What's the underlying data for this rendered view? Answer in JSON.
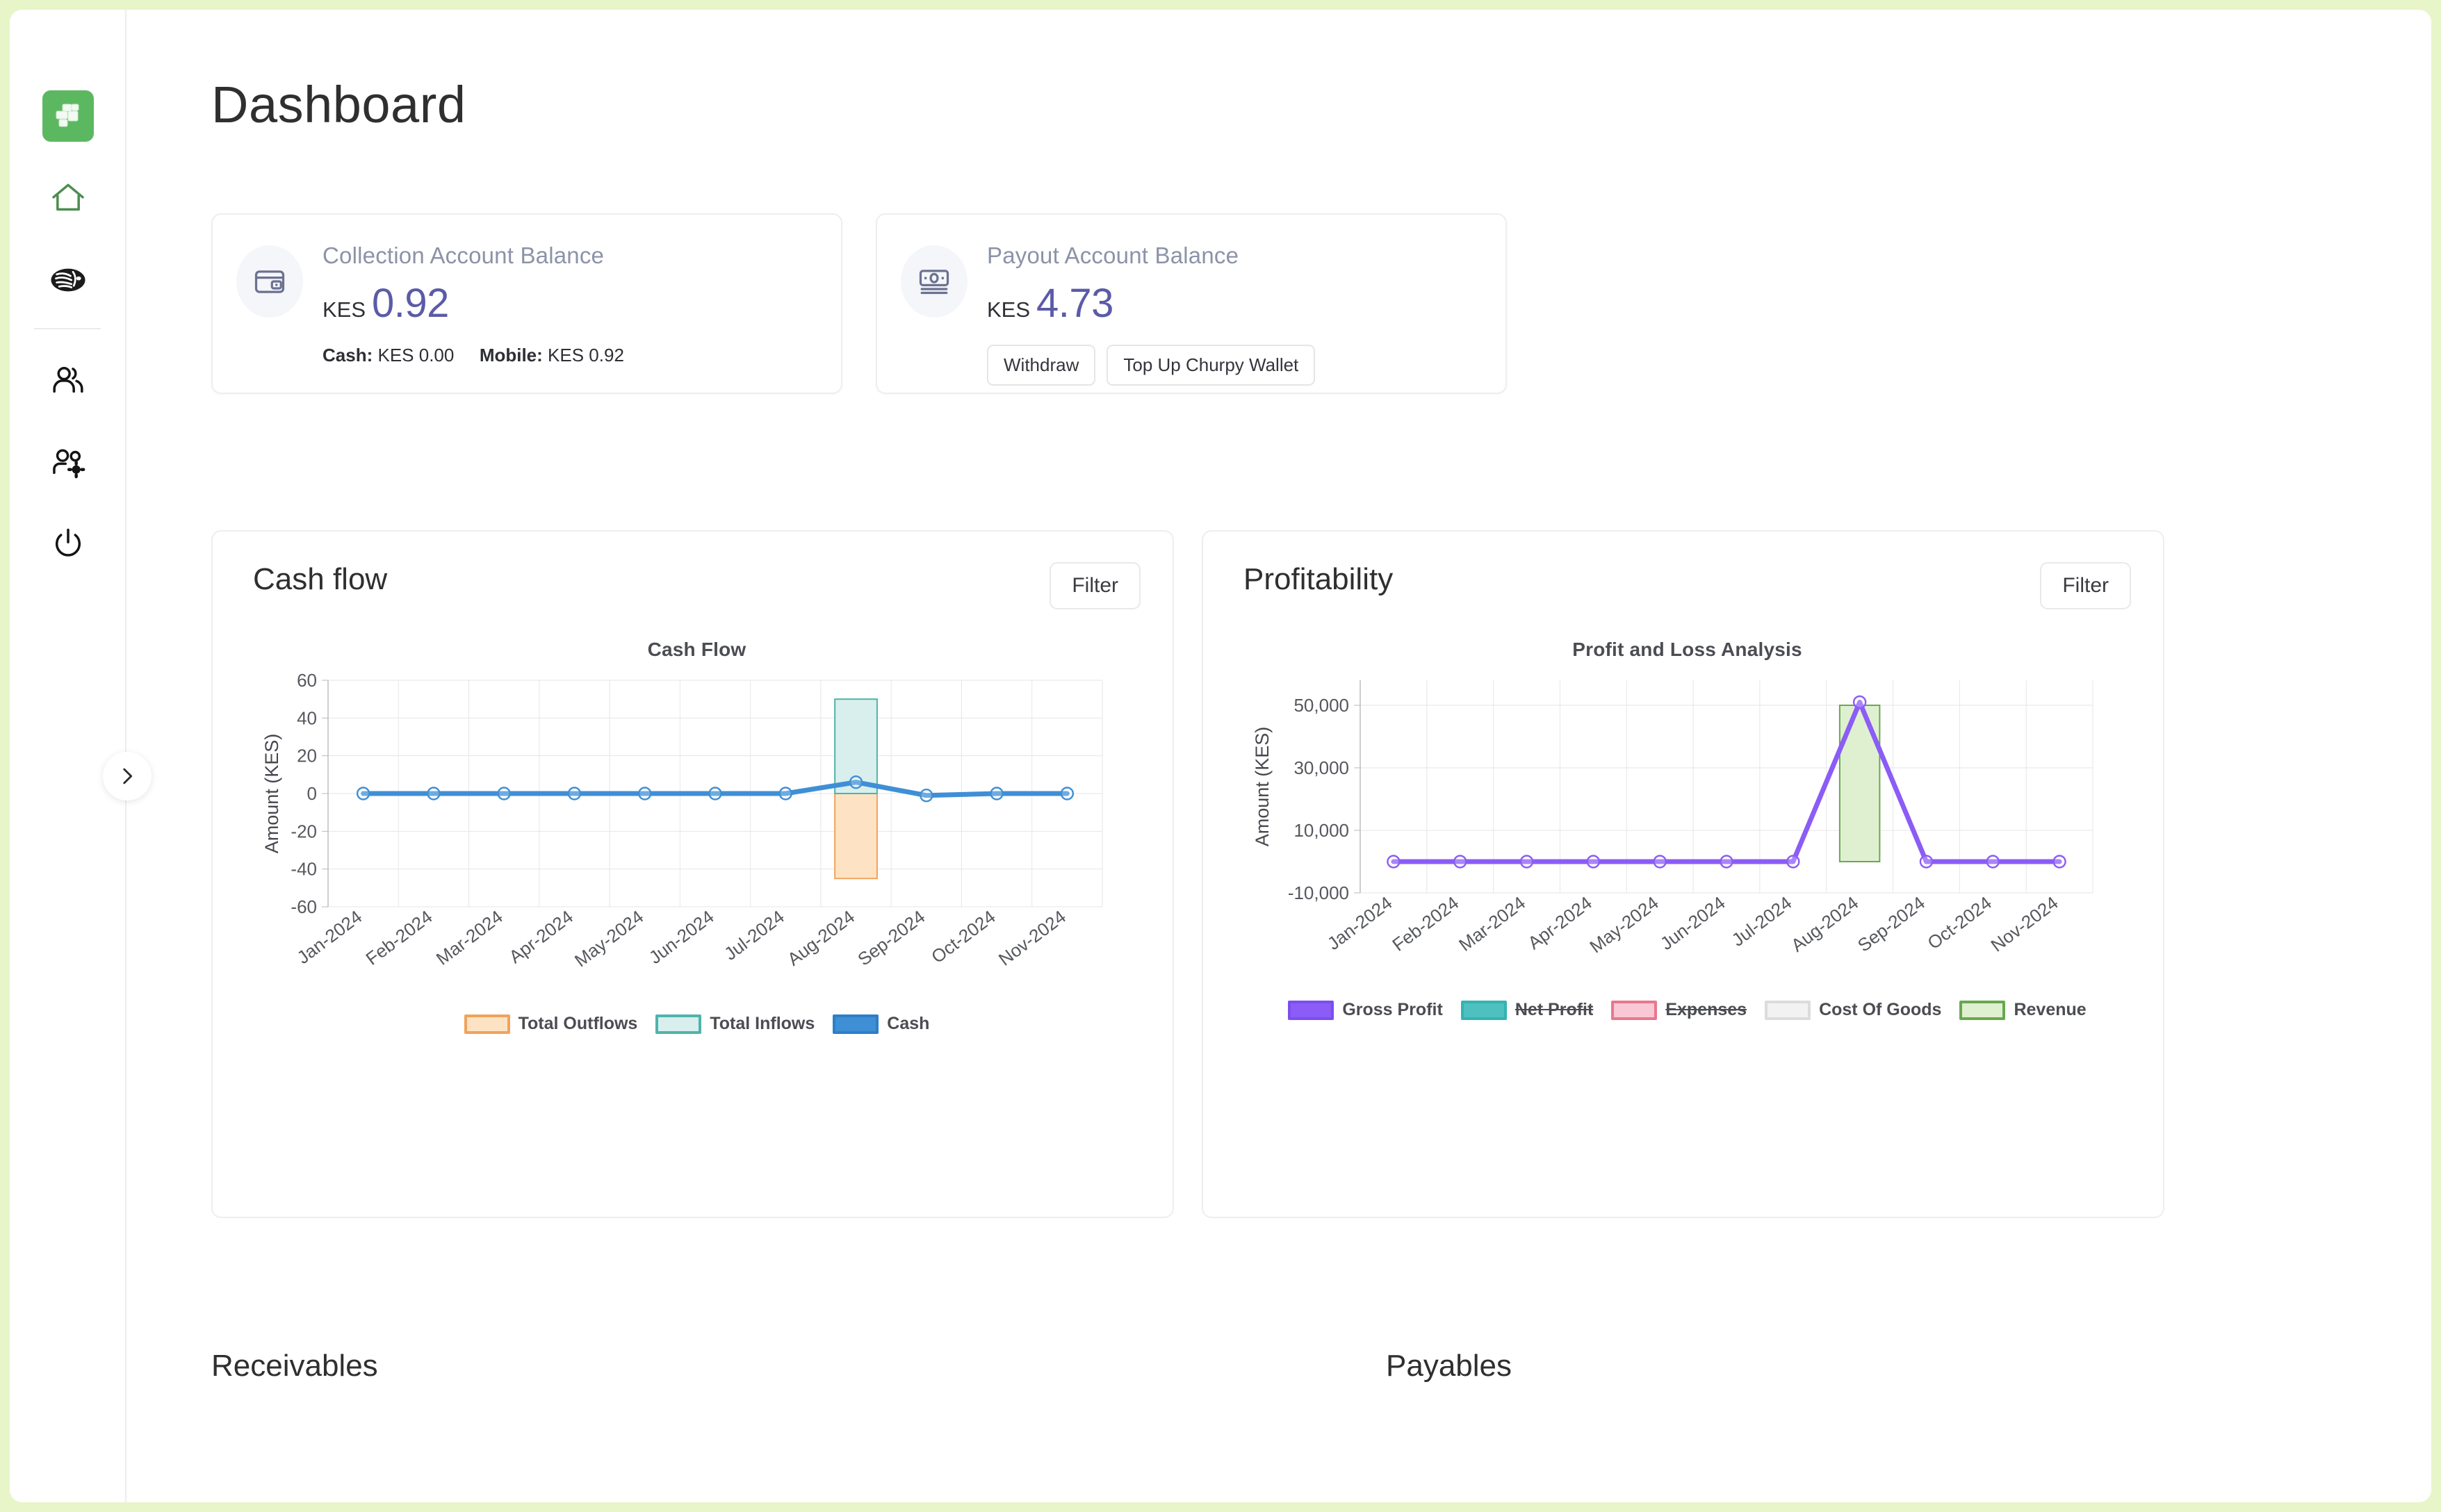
{
  "app": {
    "logo_icon": "churpy-cards-logo",
    "accent_green": "#5cb860",
    "page_border_color": "#e8f5c8"
  },
  "sidebar": {
    "items": [
      {
        "name": "logo",
        "icon": "churpy-logo-icon"
      },
      {
        "name": "home",
        "icon": "home-icon"
      },
      {
        "name": "lion",
        "icon": "lion-icon"
      },
      {
        "name": "customers",
        "icon": "users-icon"
      },
      {
        "name": "user-admin",
        "icon": "users-gear-icon"
      },
      {
        "name": "logout",
        "icon": "power-icon"
      }
    ],
    "expand_icon": "chevron-right-icon"
  },
  "header": {
    "title": "Dashboard"
  },
  "cards": {
    "collection": {
      "icon": "wallet-icon",
      "label": "Collection Account Balance",
      "currency": "KES",
      "amount": "0.92",
      "cash_label": "Cash:",
      "cash_value": "KES 0.00",
      "mobile_label": "Mobile:",
      "mobile_value": "KES 0.92"
    },
    "payout": {
      "icon": "banknote-icon",
      "label": "Payout Account Balance",
      "currency": "KES",
      "amount": "4.73",
      "withdraw_label": "Withdraw",
      "topup_label": "Top Up Churpy Wallet"
    }
  },
  "panels": {
    "cashflow": {
      "title": "Cash flow",
      "filter_label": "Filter"
    },
    "profitability": {
      "title": "Profitability",
      "filter_label": "Filter"
    }
  },
  "bottom": {
    "receivables_title": "Receivables",
    "payables_title": "Payables"
  },
  "chart_data": [
    {
      "id": "cash-flow",
      "type": "bar",
      "title": "Cash Flow",
      "xlabel": "",
      "ylabel": "Amount (KES)",
      "ylim": [
        -60,
        60
      ],
      "yticks": [
        60,
        40,
        20,
        0,
        -20,
        -40,
        -60
      ],
      "grid": true,
      "legend_position": "bottom",
      "categories": [
        "Jan-2024",
        "Feb-2024",
        "Mar-2024",
        "Apr-2024",
        "May-2024",
        "Jun-2024",
        "Jul-2024",
        "Aug-2024",
        "Sep-2024",
        "Oct-2024",
        "Nov-2024"
      ],
      "series": [
        {
          "name": "Total Outflows",
          "type": "bar",
          "color": "#fde3c4",
          "border": "#f0a35a",
          "values": [
            0,
            0,
            0,
            0,
            0,
            0,
            0,
            -45,
            0,
            0,
            0
          ]
        },
        {
          "name": "Total Inflows",
          "type": "bar",
          "color": "#d9efed",
          "border": "#4fb3ac",
          "values": [
            0,
            0,
            0,
            0,
            0,
            0,
            0,
            50,
            0,
            0,
            0
          ]
        },
        {
          "name": "Cash",
          "type": "line",
          "color": "#3f8fd6",
          "border": "#2c7fc9",
          "values": [
            0,
            0,
            0,
            0,
            0,
            0,
            0,
            6,
            -1,
            0,
            0
          ]
        }
      ]
    },
    {
      "id": "profit-and-loss",
      "type": "bar",
      "title": "Profit and Loss Analysis",
      "xlabel": "",
      "ylabel": "Amount (KES)",
      "ylim": [
        -10000,
        58000
      ],
      "yticks": [
        50000,
        30000,
        10000,
        -10000
      ],
      "ytick_labels": [
        "50,000",
        "30,000",
        "10,000",
        "-10,000"
      ],
      "grid": true,
      "legend_position": "bottom",
      "categories": [
        "Jan-2024",
        "Feb-2024",
        "Mar-2024",
        "Apr-2024",
        "May-2024",
        "Jun-2024",
        "Jul-2024",
        "Aug-2024",
        "Sep-2024",
        "Oct-2024",
        "Nov-2024"
      ],
      "series": [
        {
          "name": "Gross Profit",
          "type": "line",
          "color": "#8b5cf6",
          "border": "#7c4ef0",
          "visible": true,
          "values": [
            0,
            0,
            0,
            0,
            0,
            0,
            0,
            51000,
            0,
            0,
            0
          ]
        },
        {
          "name": "Net Profit",
          "type": "line",
          "color": "#4fc0c0",
          "border": "#34b3b3",
          "visible": false,
          "values": [
            0,
            0,
            0,
            0,
            0,
            0,
            0,
            0,
            0,
            0,
            0
          ]
        },
        {
          "name": "Expenses",
          "type": "bar",
          "color": "#f9c8d4",
          "border": "#e8778f",
          "visible": false,
          "values": [
            0,
            0,
            0,
            0,
            0,
            0,
            0,
            0,
            0,
            0,
            0
          ]
        },
        {
          "name": "Cost Of Goods",
          "type": "bar",
          "color": "#f2f2f2",
          "border": "#dcdcdc",
          "visible": true,
          "values": [
            0,
            0,
            0,
            0,
            0,
            0,
            0,
            0,
            0,
            0,
            0
          ]
        },
        {
          "name": "Revenue",
          "type": "bar",
          "color": "#dff0d0",
          "border": "#69a84f",
          "visible": true,
          "values": [
            0,
            0,
            0,
            0,
            0,
            0,
            0,
            50000,
            0,
            0,
            0
          ]
        }
      ]
    }
  ]
}
